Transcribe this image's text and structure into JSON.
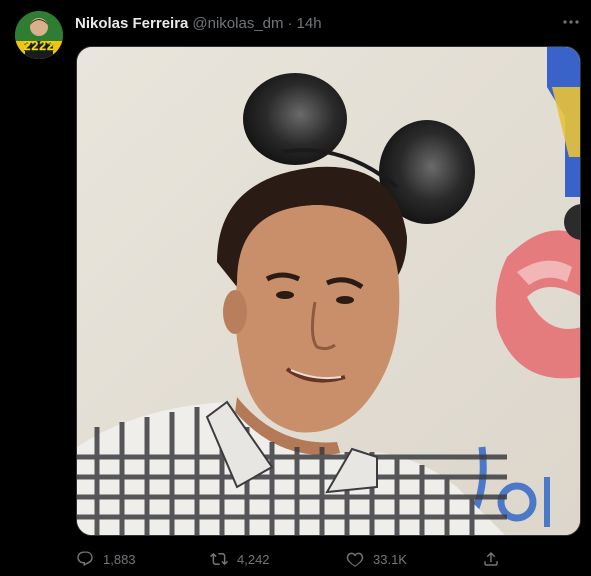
{
  "tweet": {
    "author": {
      "display_name": "Nikolas Ferreira",
      "handle": "@nikolas_dm",
      "avatar_badge": "2222"
    },
    "separator": "·",
    "time": "14h",
    "actions": {
      "replies": "1,883",
      "retweets": "4,242",
      "likes": "33.1K"
    }
  },
  "icons": {
    "more": "more-horizontal-icon",
    "reply": "reply-icon",
    "retweet": "retweet-icon",
    "like": "heart-icon",
    "share": "share-icon"
  },
  "colors": {
    "background": "#000000",
    "text_primary": "#e7e9ea",
    "text_secondary": "#71767b",
    "badge": "#ffd21a",
    "avatar_bg": "#2f7d32"
  }
}
